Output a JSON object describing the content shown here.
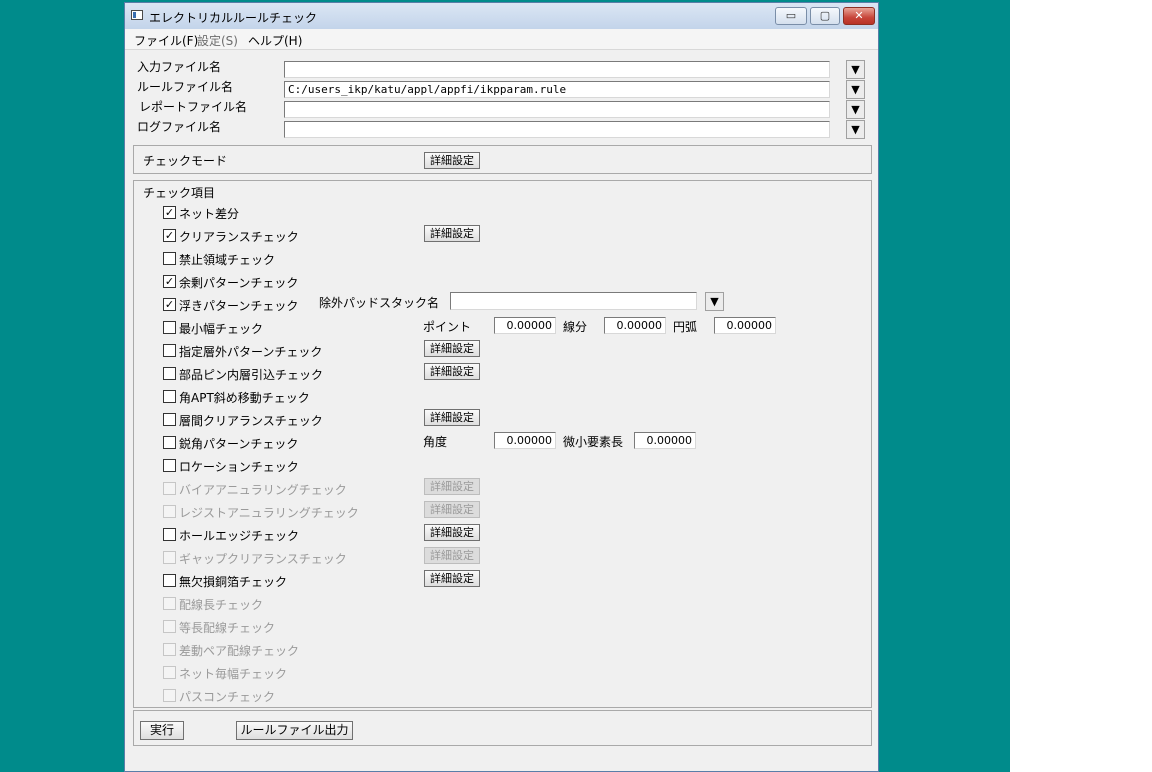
{
  "window": {
    "title": "エレクトリカルルールチェック",
    "min_glyph": "▭",
    "max_glyph": "▢",
    "close_glyph": "✕"
  },
  "menubar": {
    "items": [
      "ファイル(F)",
      "設定(S)",
      "ヘルプ(H)"
    ]
  },
  "files": {
    "input_label": "入力ファイル名",
    "input_value": "",
    "rule_label": "ルールファイル名",
    "rule_value": "C:/users_ikp/katu/appl/appfi/ikpparam.rule",
    "report_label": "レポートファイル名",
    "report_value": "",
    "log_label": "ログファイル名",
    "log_value": "",
    "dropdown_glyph": "▼"
  },
  "mode": {
    "label": "チェックモード",
    "detail_button": "詳細設定"
  },
  "checks": {
    "header": "チェック項目",
    "check_glyph": "✓",
    "detail_button": "詳細設定",
    "items": [
      {
        "label": "ネット差分",
        "checked": true,
        "enabled": true
      },
      {
        "label": "クリアランスチェック",
        "checked": true,
        "enabled": true
      },
      {
        "label": "禁止領域チェック",
        "checked": false,
        "enabled": true
      },
      {
        "label": "余剰パターンチェック",
        "checked": true,
        "enabled": true
      },
      {
        "label": "浮きパターンチェック",
        "checked": true,
        "enabled": true
      },
      {
        "label": "最小幅チェック",
        "checked": false,
        "enabled": true
      },
      {
        "label": "指定層外パターンチェック",
        "checked": false,
        "enabled": true
      },
      {
        "label": "部品ピン内層引込チェック",
        "checked": false,
        "enabled": true
      },
      {
        "label": "角APT斜め移動チェック",
        "checked": false,
        "enabled": true
      },
      {
        "label": "層間クリアランスチェック",
        "checked": false,
        "enabled": true
      },
      {
        "label": "鋭角パターンチェック",
        "checked": false,
        "enabled": true
      },
      {
        "label": "ロケーションチェック",
        "checked": false,
        "enabled": true
      },
      {
        "label": "バイアアニュラリングチェック",
        "checked": false,
        "enabled": false
      },
      {
        "label": "レジストアニュラリングチェック",
        "checked": false,
        "enabled": false
      },
      {
        "label": "ホールエッジチェック",
        "checked": false,
        "enabled": true
      },
      {
        "label": "ギャップクリアランスチェック",
        "checked": false,
        "enabled": false
      },
      {
        "label": "無欠損銅箔チェック",
        "checked": false,
        "enabled": true
      },
      {
        "label": "配線長チェック",
        "checked": false,
        "enabled": false
      },
      {
        "label": "等長配線チェック",
        "checked": false,
        "enabled": false
      },
      {
        "label": "差動ペア配線チェック",
        "checked": false,
        "enabled": false
      },
      {
        "label": "ネット毎幅チェック",
        "checked": false,
        "enabled": false
      },
      {
        "label": "パスコンチェック",
        "checked": false,
        "enabled": false
      }
    ],
    "exclude_pad_label": "除外パッドスタック名",
    "exclude_pad_value": "",
    "min_width": {
      "point_label": "ポイント",
      "point_value": "0.00000",
      "line_label": "線分",
      "line_value": "0.00000",
      "arc_label": "円弧",
      "arc_value": "0.00000"
    },
    "acute": {
      "angle_label": "角度",
      "angle_value": "0.00000",
      "small_label": "微小要素長",
      "small_value": "0.00000"
    }
  },
  "footer": {
    "run_button": "実行",
    "rule_output_button": "ルールファイル出力"
  }
}
